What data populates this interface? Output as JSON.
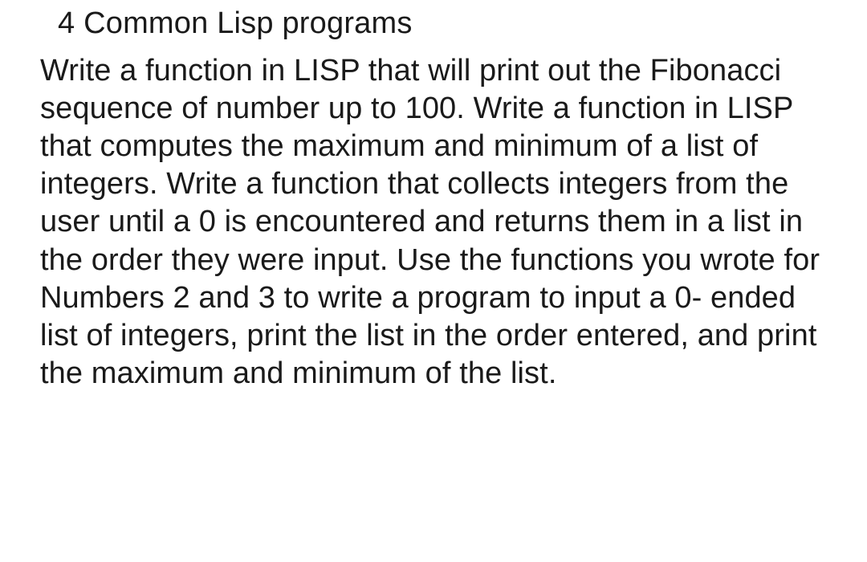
{
  "document": {
    "title": "4 Common Lisp programs",
    "body": "Write a function in LISP that will print out the Fibonacci sequence of number up to 100. Write a function in LISP that computes the maximum and minimum of a list of integers. Write a function that collects integers from the user until a 0 is encountered and returns them in a list in the order they were input. Use the functions you wrote for Numbers 2 and 3 to write a program to input a 0- ended list of integers, print the list in the order entered, and print the maximum and minimum of the list."
  }
}
